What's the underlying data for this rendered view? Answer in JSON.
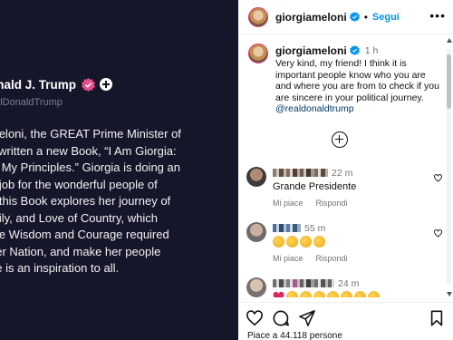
{
  "media": {
    "author_name": "onald J. Trump",
    "handle": "ealDonaldTrump",
    "body_lines": [
      "Meloni, the GREAT Prime Minister of",
      "s written a new Book, “I Am Giorgia:",
      "s, My Principles.” Giorgia is doing an",
      "e job for the wonderful people of",
      "d this Book explores her journey of",
      "mily, and Love of Country, which",
      " the Wisdom and Courage required",
      "her Nation, and make her people",
      "he is an inspiration to all."
    ]
  },
  "header": {
    "username": "giorgiameloni",
    "separator": "•",
    "follow_label": "Segui",
    "more_label": "•••"
  },
  "caption": {
    "username": "giorgiameloni",
    "time": "1 h",
    "text": "Very kind, my friend! I think it is important people know who you are and where you are from to check if you are sincere in your political journey.",
    "mention": "@realdonaldtrump"
  },
  "comments": [
    {
      "time": "22 m",
      "text": "Grande Presidente",
      "like_label": "Mi piace",
      "reply_label": "Rispondi"
    },
    {
      "time": "55 m",
      "reactions": [
        "clap",
        "clap",
        "clap",
        "clap"
      ],
      "like_label": "Mi piace",
      "reply_label": "Rispondi"
    },
    {
      "time": "24 m",
      "reactions": [
        "heart",
        "clap",
        "clap",
        "clap",
        "clap",
        "clap",
        "clap",
        "clap"
      ]
    }
  ],
  "footer": {
    "likes_text": "Piace a 44.118 persone"
  },
  "colors": {
    "media_bg": "#15162a",
    "accent": "#0095f6",
    "verified": "#0095f6",
    "mention": "#00376b",
    "muted": "#737373"
  }
}
